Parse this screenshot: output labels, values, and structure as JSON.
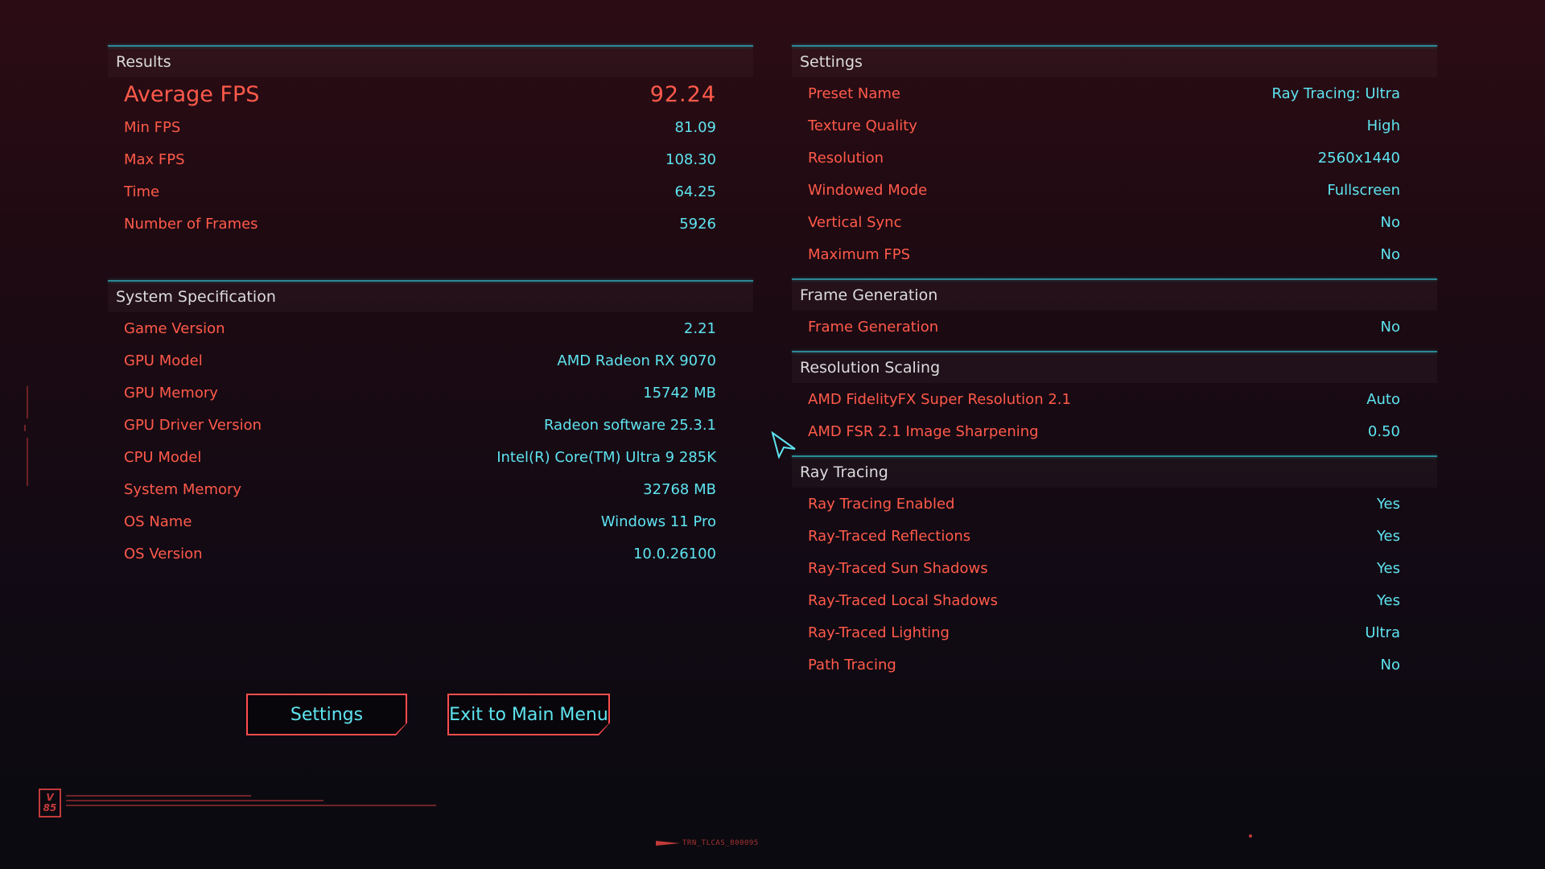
{
  "results": {
    "title": "Results",
    "average": {
      "label": "Average FPS",
      "value": "92.24"
    },
    "rows": [
      {
        "label": "Min FPS",
        "value": "81.09"
      },
      {
        "label": "Max FPS",
        "value": "108.30"
      },
      {
        "label": "Time",
        "value": "64.25"
      },
      {
        "label": "Number of Frames",
        "value": "5926"
      }
    ]
  },
  "system": {
    "title": "System Specification",
    "rows": [
      {
        "label": "Game Version",
        "value": "2.21"
      },
      {
        "label": "GPU Model",
        "value": "AMD Radeon RX 9070"
      },
      {
        "label": "GPU Memory",
        "value": "15742 MB"
      },
      {
        "label": "GPU Driver Version",
        "value": "Radeon software 25.3.1"
      },
      {
        "label": "CPU Model",
        "value": "Intel(R) Core(TM) Ultra 9 285K"
      },
      {
        "label": "System Memory",
        "value": "32768 MB"
      },
      {
        "label": "OS Name",
        "value": "Windows 11 Pro"
      },
      {
        "label": "OS Version",
        "value": "10.0.26100"
      }
    ]
  },
  "settings": {
    "title": "Settings",
    "rows": [
      {
        "label": "Preset Name",
        "value": "Ray Tracing: Ultra"
      },
      {
        "label": "Texture Quality",
        "value": "High"
      },
      {
        "label": "Resolution",
        "value": "2560x1440"
      },
      {
        "label": "Windowed Mode",
        "value": "Fullscreen"
      },
      {
        "label": "Vertical Sync",
        "value": "No"
      },
      {
        "label": "Maximum FPS",
        "value": "No"
      }
    ]
  },
  "frame_generation": {
    "title": "Frame Generation",
    "rows": [
      {
        "label": "Frame Generation",
        "value": "No"
      }
    ]
  },
  "resolution_scaling": {
    "title": "Resolution Scaling",
    "rows": [
      {
        "label": "AMD FidelityFX Super Resolution 2.1",
        "value": "Auto"
      },
      {
        "label": "AMD FSR 2.1 Image Sharpening",
        "value": "0.50"
      }
    ]
  },
  "ray_tracing": {
    "title": "Ray Tracing",
    "rows": [
      {
        "label": "Ray Tracing Enabled",
        "value": "Yes"
      },
      {
        "label": "Ray-Traced Reflections",
        "value": "Yes"
      },
      {
        "label": "Ray-Traced Sun Shadows",
        "value": "Yes"
      },
      {
        "label": "Ray-Traced Local Shadows",
        "value": "Yes"
      },
      {
        "label": "Ray-Traced Lighting",
        "value": "Ultra"
      },
      {
        "label": "Path Tracing",
        "value": "No"
      }
    ]
  },
  "buttons": {
    "settings": "Settings",
    "exit": "Exit to Main Menu"
  },
  "footer": {
    "logo_top": "V",
    "logo_bottom": "85",
    "code": "TRN_TLCAS_800095"
  },
  "colors": {
    "label": "#ff5a4a",
    "value": "#5ee4f0",
    "accent_line": "#2a8a96"
  }
}
